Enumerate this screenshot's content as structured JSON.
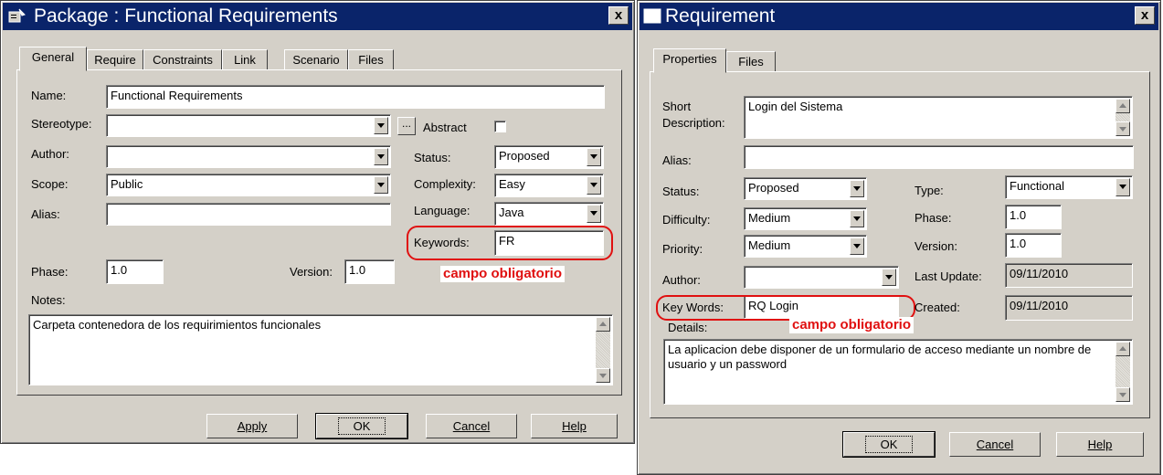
{
  "package_window": {
    "title": "Package : Functional Requirements",
    "close_glyph": "x",
    "icon": "package-properties-icon",
    "tabs": [
      "General",
      "Require",
      "Constraints",
      "Link",
      "Scenario",
      "Files"
    ],
    "active_tab": "General",
    "labels": {
      "name": "Name:",
      "stereotype": "Stereotype:",
      "author": "Author:",
      "scope": "Scope:",
      "alias": "Alias:",
      "abstract": "Abstract",
      "status": "Status:",
      "complexity": "Complexity:",
      "language": "Language:",
      "keywords": "Keywords:",
      "phase": "Phase:",
      "version": "Version:",
      "notes": "Notes:"
    },
    "values": {
      "name": "Functional Requirements",
      "stereotype": "",
      "author": "",
      "scope": "Public",
      "alias": "",
      "status": "Proposed",
      "complexity": "Easy",
      "language": "Java",
      "keywords": "FR",
      "phase": "1.0",
      "version": "1.0",
      "notes": "Carpeta contenedora de los requirimientos funcionales"
    },
    "stereotype_button": "...",
    "abstract_checked": false,
    "annotation": "campo obligatorio",
    "buttons": {
      "apply": "Apply",
      "ok": "OK",
      "cancel": "Cancel",
      "help": "Help"
    }
  },
  "requirement_window": {
    "title": "Requirement",
    "close_glyph": "x",
    "icon": "window-icon",
    "tabs": [
      "Properties",
      "Files"
    ],
    "active_tab": "Properties",
    "labels": {
      "short_description_1": "Short",
      "short_description_2": "Description:",
      "alias": "Alias:",
      "status": "Status:",
      "difficulty": "Difficulty:",
      "priority": "Priority:",
      "author": "Author:",
      "key_words": "Key Words:",
      "details": "Details:",
      "type": "Type:",
      "phase": "Phase:",
      "version": "Version:",
      "last_update": "Last Update:",
      "created": "Created:"
    },
    "values": {
      "short_description": "Login del Sistema",
      "alias": "",
      "status": "Proposed",
      "difficulty": "Medium",
      "priority": "Medium",
      "author": "",
      "key_words": "RQ Login",
      "type": "Functional",
      "phase": "1.0",
      "version": "1.0",
      "last_update": "09/11/2010",
      "created": "09/11/2010",
      "details": "La aplicacion debe disponer de un formulario de acceso mediante un nombre de usuario y un password"
    },
    "annotation": "campo obligatorio",
    "buttons": {
      "ok": "OK",
      "cancel": "Cancel",
      "help": "Help"
    }
  },
  "colors": {
    "titlebar": "#0a246a",
    "dialog_face": "#d4d0c8",
    "highlight_red": "#e01010"
  }
}
